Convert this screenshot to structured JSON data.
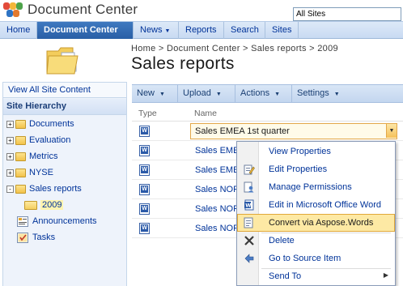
{
  "header": {
    "site_title": "Document Center",
    "site_selector": "All Sites"
  },
  "nav": {
    "tabs": [
      {
        "label": "Home",
        "active": false,
        "has_menu": false
      },
      {
        "label": "Document Center",
        "active": true,
        "has_menu": false
      },
      {
        "label": "News",
        "active": false,
        "has_menu": true
      },
      {
        "label": "Reports",
        "active": false,
        "has_menu": false
      },
      {
        "label": "Search",
        "active": false,
        "has_menu": false
      },
      {
        "label": "Sites",
        "active": false,
        "has_menu": false
      }
    ]
  },
  "page": {
    "breadcrumb": "Home > Document Center > Sales reports > 2009",
    "title": "Sales reports"
  },
  "sidebar": {
    "view_all": "View All Site Content",
    "hierarchy_title": "Site Hierarchy",
    "items": [
      {
        "label": "Documents",
        "expand": "+",
        "kind": "folder"
      },
      {
        "label": "Evaluation",
        "expand": "+",
        "kind": "folder"
      },
      {
        "label": "Metrics",
        "expand": "+",
        "kind": "folder"
      },
      {
        "label": "NYSE",
        "expand": "+",
        "kind": "folder"
      },
      {
        "label": "Sales reports",
        "expand": "-",
        "kind": "folder"
      },
      {
        "label": "2009",
        "expand": "",
        "kind": "folder-open",
        "selected": true
      },
      {
        "label": "Announcements",
        "expand": "",
        "kind": "list"
      },
      {
        "label": "Tasks",
        "expand": "",
        "kind": "tasks"
      }
    ]
  },
  "toolbar": {
    "buttons": [
      {
        "label": "New"
      },
      {
        "label": "Upload"
      },
      {
        "label": "Actions"
      },
      {
        "label": "Settings"
      }
    ]
  },
  "list": {
    "columns": [
      "Type",
      "Name"
    ],
    "rows": [
      {
        "type_icon": "word-doc-icon",
        "name": "Sales EMEA 1st quarter",
        "highlighted": true
      },
      {
        "type_icon": "word-doc-icon",
        "name": "Sales EMEA",
        "highlighted": false
      },
      {
        "type_icon": "word-doc-icon",
        "name": "Sales EMEA",
        "highlighted": false
      },
      {
        "type_icon": "word-doc-icon",
        "name": "Sales NOR",
        "highlighted": false
      },
      {
        "type_icon": "word-doc-icon",
        "name": "Sales NOR",
        "highlighted": false
      },
      {
        "type_icon": "word-doc-icon",
        "name": "Sales NOR",
        "highlighted": false
      }
    ]
  },
  "context_menu": {
    "items": [
      {
        "label": "View Properties",
        "icon": "",
        "active": false,
        "submenu": false
      },
      {
        "label": "Edit Properties",
        "icon": "edit-properties-icon",
        "active": false,
        "submenu": false
      },
      {
        "label": "Manage Permissions",
        "icon": "permissions-icon",
        "active": false,
        "submenu": false
      },
      {
        "label": "Edit in Microsoft Office Word",
        "icon": "word-edit-icon",
        "active": false,
        "submenu": false
      },
      {
        "label": "Convert via Aspose.Words",
        "icon": "convert-icon",
        "active": true,
        "submenu": false
      },
      {
        "label": "Delete",
        "icon": "delete-x-icon",
        "active": false,
        "submenu": false
      },
      {
        "label": "Go to Source Item",
        "icon": "source-item-icon",
        "active": false,
        "submenu": false
      },
      {
        "label": "Send To",
        "icon": "",
        "active": false,
        "submenu": true
      }
    ]
  },
  "colors": {
    "link": "#003399",
    "nav_active": "#2a5fa6",
    "highlight": "#fde9a4",
    "highlight_border": "#e0a83a"
  }
}
